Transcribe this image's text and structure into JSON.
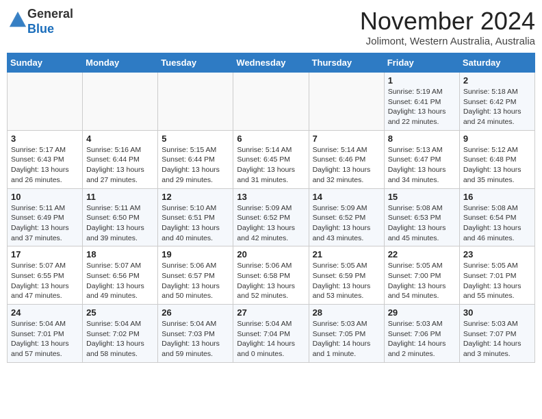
{
  "header": {
    "logo_general": "General",
    "logo_blue": "Blue",
    "month_title": "November 2024",
    "location": "Jolimont, Western Australia, Australia"
  },
  "weekdays": [
    "Sunday",
    "Monday",
    "Tuesday",
    "Wednesday",
    "Thursday",
    "Friday",
    "Saturday"
  ],
  "weeks": [
    [
      {
        "day": "",
        "info": ""
      },
      {
        "day": "",
        "info": ""
      },
      {
        "day": "",
        "info": ""
      },
      {
        "day": "",
        "info": ""
      },
      {
        "day": "",
        "info": ""
      },
      {
        "day": "1",
        "info": "Sunrise: 5:19 AM\nSunset: 6:41 PM\nDaylight: 13 hours\nand 22 minutes."
      },
      {
        "day": "2",
        "info": "Sunrise: 5:18 AM\nSunset: 6:42 PM\nDaylight: 13 hours\nand 24 minutes."
      }
    ],
    [
      {
        "day": "3",
        "info": "Sunrise: 5:17 AM\nSunset: 6:43 PM\nDaylight: 13 hours\nand 26 minutes."
      },
      {
        "day": "4",
        "info": "Sunrise: 5:16 AM\nSunset: 6:44 PM\nDaylight: 13 hours\nand 27 minutes."
      },
      {
        "day": "5",
        "info": "Sunrise: 5:15 AM\nSunset: 6:44 PM\nDaylight: 13 hours\nand 29 minutes."
      },
      {
        "day": "6",
        "info": "Sunrise: 5:14 AM\nSunset: 6:45 PM\nDaylight: 13 hours\nand 31 minutes."
      },
      {
        "day": "7",
        "info": "Sunrise: 5:14 AM\nSunset: 6:46 PM\nDaylight: 13 hours\nand 32 minutes."
      },
      {
        "day": "8",
        "info": "Sunrise: 5:13 AM\nSunset: 6:47 PM\nDaylight: 13 hours\nand 34 minutes."
      },
      {
        "day": "9",
        "info": "Sunrise: 5:12 AM\nSunset: 6:48 PM\nDaylight: 13 hours\nand 35 minutes."
      }
    ],
    [
      {
        "day": "10",
        "info": "Sunrise: 5:11 AM\nSunset: 6:49 PM\nDaylight: 13 hours\nand 37 minutes."
      },
      {
        "day": "11",
        "info": "Sunrise: 5:11 AM\nSunset: 6:50 PM\nDaylight: 13 hours\nand 39 minutes."
      },
      {
        "day": "12",
        "info": "Sunrise: 5:10 AM\nSunset: 6:51 PM\nDaylight: 13 hours\nand 40 minutes."
      },
      {
        "day": "13",
        "info": "Sunrise: 5:09 AM\nSunset: 6:52 PM\nDaylight: 13 hours\nand 42 minutes."
      },
      {
        "day": "14",
        "info": "Sunrise: 5:09 AM\nSunset: 6:52 PM\nDaylight: 13 hours\nand 43 minutes."
      },
      {
        "day": "15",
        "info": "Sunrise: 5:08 AM\nSunset: 6:53 PM\nDaylight: 13 hours\nand 45 minutes."
      },
      {
        "day": "16",
        "info": "Sunrise: 5:08 AM\nSunset: 6:54 PM\nDaylight: 13 hours\nand 46 minutes."
      }
    ],
    [
      {
        "day": "17",
        "info": "Sunrise: 5:07 AM\nSunset: 6:55 PM\nDaylight: 13 hours\nand 47 minutes."
      },
      {
        "day": "18",
        "info": "Sunrise: 5:07 AM\nSunset: 6:56 PM\nDaylight: 13 hours\nand 49 minutes."
      },
      {
        "day": "19",
        "info": "Sunrise: 5:06 AM\nSunset: 6:57 PM\nDaylight: 13 hours\nand 50 minutes."
      },
      {
        "day": "20",
        "info": "Sunrise: 5:06 AM\nSunset: 6:58 PM\nDaylight: 13 hours\nand 52 minutes."
      },
      {
        "day": "21",
        "info": "Sunrise: 5:05 AM\nSunset: 6:59 PM\nDaylight: 13 hours\nand 53 minutes."
      },
      {
        "day": "22",
        "info": "Sunrise: 5:05 AM\nSunset: 7:00 PM\nDaylight: 13 hours\nand 54 minutes."
      },
      {
        "day": "23",
        "info": "Sunrise: 5:05 AM\nSunset: 7:01 PM\nDaylight: 13 hours\nand 55 minutes."
      }
    ],
    [
      {
        "day": "24",
        "info": "Sunrise: 5:04 AM\nSunset: 7:01 PM\nDaylight: 13 hours\nand 57 minutes."
      },
      {
        "day": "25",
        "info": "Sunrise: 5:04 AM\nSunset: 7:02 PM\nDaylight: 13 hours\nand 58 minutes."
      },
      {
        "day": "26",
        "info": "Sunrise: 5:04 AM\nSunset: 7:03 PM\nDaylight: 13 hours\nand 59 minutes."
      },
      {
        "day": "27",
        "info": "Sunrise: 5:04 AM\nSunset: 7:04 PM\nDaylight: 14 hours\nand 0 minutes."
      },
      {
        "day": "28",
        "info": "Sunrise: 5:03 AM\nSunset: 7:05 PM\nDaylight: 14 hours\nand 1 minute."
      },
      {
        "day": "29",
        "info": "Sunrise: 5:03 AM\nSunset: 7:06 PM\nDaylight: 14 hours\nand 2 minutes."
      },
      {
        "day": "30",
        "info": "Sunrise: 5:03 AM\nSunset: 7:07 PM\nDaylight: 14 hours\nand 3 minutes."
      }
    ]
  ]
}
